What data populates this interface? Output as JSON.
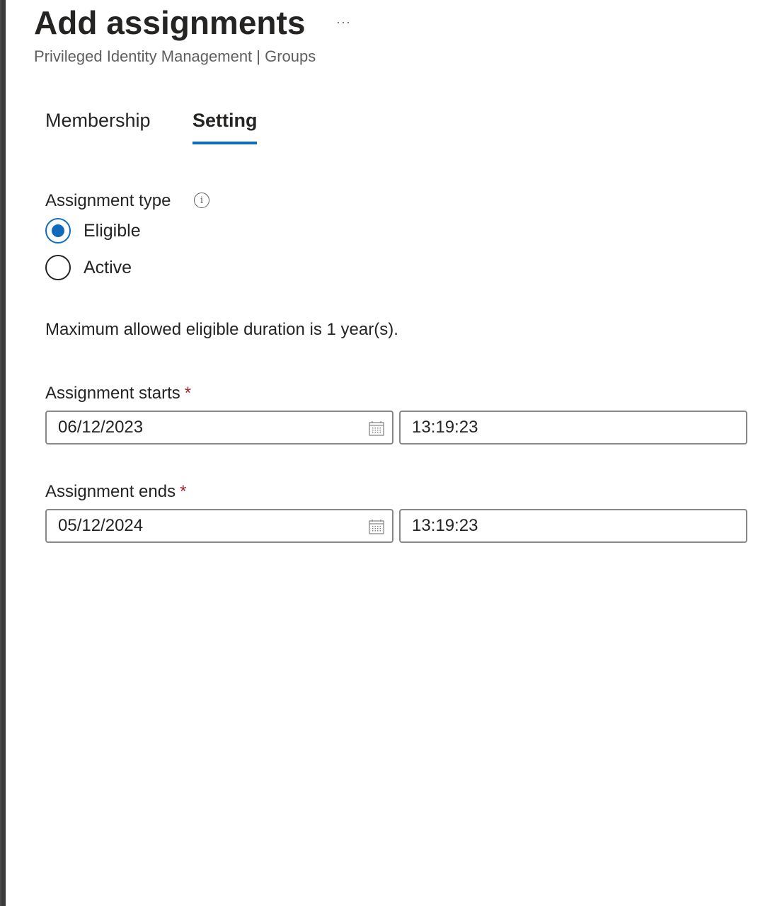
{
  "header": {
    "title": "Add assignments",
    "more_icon": "ellipsis-icon",
    "subtitle": "Privileged Identity Management | Groups"
  },
  "tabs": [
    {
      "label": "Membership",
      "selected": false
    },
    {
      "label": "Setting",
      "selected": true
    }
  ],
  "assignment_type": {
    "label": "Assignment type",
    "info_icon": "info-icon",
    "info_glyph": "i",
    "options": [
      {
        "label": "Eligible",
        "checked": true
      },
      {
        "label": "Active",
        "checked": false
      }
    ]
  },
  "duration_note": "Maximum allowed eligible duration is 1 year(s).",
  "assignment_starts": {
    "label": "Assignment starts",
    "required_mark": "*",
    "date": "06/12/2023",
    "time": "13:19:23",
    "calendar_icon": "calendar-icon"
  },
  "assignment_ends": {
    "label": "Assignment ends",
    "required_mark": "*",
    "date": "05/12/2024",
    "time": "13:19:23",
    "calendar_icon": "calendar-icon"
  },
  "colors": {
    "accent": "#0f6cbd",
    "required": "#a4262c",
    "text": "#252423",
    "subtext": "#605e5c",
    "input_border": "#8a8886"
  }
}
